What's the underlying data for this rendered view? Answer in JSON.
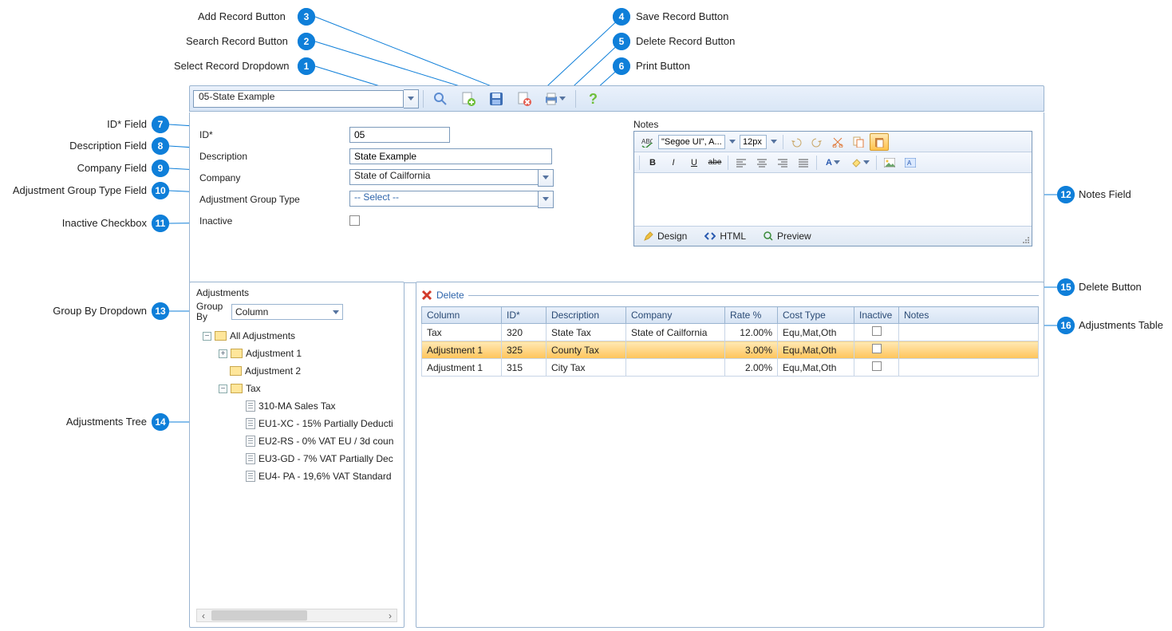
{
  "callouts": {
    "c1": {
      "num": "1",
      "label": "Select Record Dropdown"
    },
    "c2": {
      "num": "2",
      "label": "Search Record Button"
    },
    "c3": {
      "num": "3",
      "label": "Add Record Button"
    },
    "c4": {
      "num": "4",
      "label": "Save Record Button"
    },
    "c5": {
      "num": "5",
      "label": "Delete Record Button"
    },
    "c6": {
      "num": "6",
      "label": "Print Button"
    },
    "c7": {
      "num": "7",
      "label": "ID* Field"
    },
    "c8": {
      "num": "8",
      "label": "Description Field"
    },
    "c9": {
      "num": "9",
      "label": "Company Field"
    },
    "c10": {
      "num": "10",
      "label": "Adjustment Group Type Field"
    },
    "c11": {
      "num": "11",
      "label": "Inactive Checkbox"
    },
    "c12": {
      "num": "12",
      "label": "Notes Field"
    },
    "c13": {
      "num": "13",
      "label": "Group By Dropdown"
    },
    "c14": {
      "num": "14",
      "label": "Adjustments Tree"
    },
    "c15": {
      "num": "15",
      "label": "Delete Button"
    },
    "c16": {
      "num": "16",
      "label": "Adjustments Table"
    }
  },
  "toolbar": {
    "record_select": "05-State Example"
  },
  "form": {
    "id_label": "ID*",
    "id_value": "05",
    "desc_label": "Description",
    "desc_value": "State Example",
    "company_label": "Company",
    "company_value": "State of Cailfornia",
    "agt_label": "Adjustment Group Type",
    "agt_value": "-- Select --",
    "inactive_label": "Inactive"
  },
  "notes": {
    "caption": "Notes",
    "font": "\"Segoe UI\", A...",
    "size": "12px",
    "tabs": {
      "design": "Design",
      "html": "HTML",
      "preview": "Preview"
    },
    "btn": {
      "b": "B",
      "i": "I",
      "u": "U"
    }
  },
  "adjustments_panel": {
    "title": "Adjustments",
    "group_by_label": "Group By",
    "group_by_value": "Column",
    "tree": {
      "root": "All Adjustments",
      "n1": "Adjustment 1",
      "n2": "Adjustment 2",
      "n3": "Tax",
      "leaves": [
        "310-MA Sales Tax",
        "EU1-XC - 15% Partially Deducti",
        "EU2-RS - 0% VAT EU / 3d coun",
        "EU3-GD - 7% VAT Partially Dec",
        "EU4- PA - 19,6% VAT Standard"
      ]
    }
  },
  "table": {
    "delete_label": "Delete",
    "headers": {
      "col": "Column",
      "id": "ID*",
      "desc": "Description",
      "company": "Company",
      "rate": "Rate %",
      "cost": "Cost Type",
      "inactive": "Inactive",
      "notes": "Notes"
    },
    "rows": [
      {
        "col": "Tax",
        "id": "320",
        "desc": "State Tax",
        "company": "State of Cailfornia",
        "rate": "12.00%",
        "cost": "Equ,Mat,Oth",
        "inactive": false,
        "selected": false
      },
      {
        "col": "Adjustment 1",
        "id": "325",
        "desc": "County Tax",
        "company": "",
        "rate": "3.00%",
        "cost": "Equ,Mat,Oth",
        "inactive": false,
        "selected": true
      },
      {
        "col": "Adjustment 1",
        "id": "315",
        "desc": "City Tax",
        "company": "",
        "rate": "2.00%",
        "cost": "Equ,Mat,Oth",
        "inactive": false,
        "selected": false
      }
    ]
  }
}
